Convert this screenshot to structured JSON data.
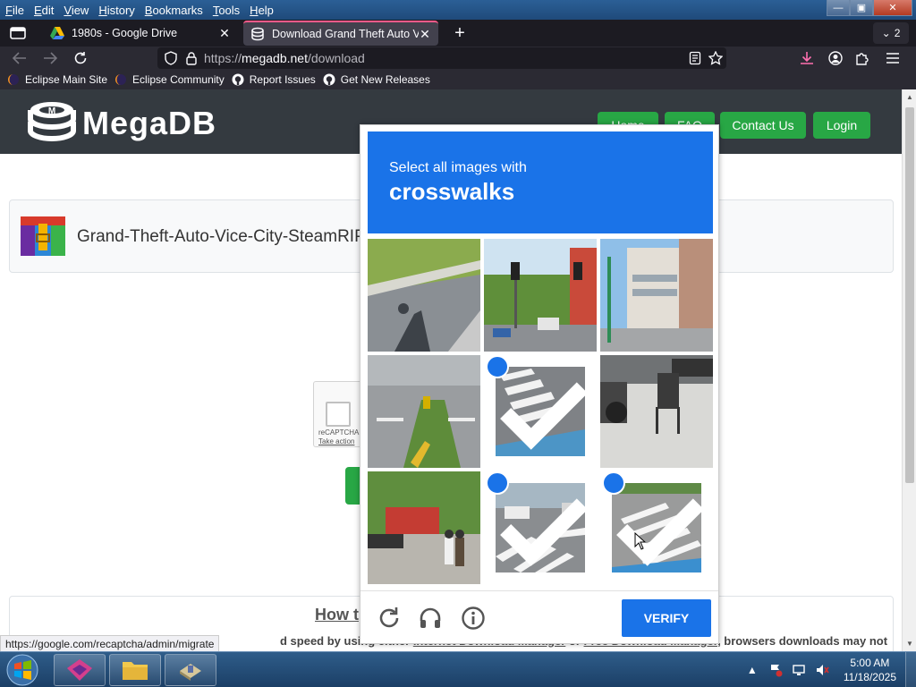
{
  "menu": {
    "items": [
      {
        "label": "File",
        "key": "F",
        "rest": "ile"
      },
      {
        "label": "Edit",
        "key": "E",
        "rest": "dit"
      },
      {
        "label": "View",
        "key": "V",
        "rest": "iew"
      },
      {
        "label": "History",
        "key": "H",
        "rest": "istory"
      },
      {
        "label": "Bookmarks",
        "key": "B",
        "rest": "ookmarks"
      },
      {
        "label": "Tools",
        "key": "T",
        "rest": "ools"
      },
      {
        "label": "Help",
        "key": "H",
        "rest": "elp"
      }
    ]
  },
  "tabs": [
    {
      "title": "1980s - Google Drive",
      "icon": "google-drive-icon"
    },
    {
      "title": "Download Grand Theft Auto Vic",
      "icon": "megadb-icon",
      "active": true
    }
  ],
  "tab_count": "2",
  "url": {
    "scheme": "https://",
    "host": "megadb.net",
    "path": "/download"
  },
  "bookmarks": [
    {
      "label": "Eclipse Main Site",
      "icon": "eclipse-icon"
    },
    {
      "label": "Eclipse Community",
      "icon": "eclipse-icon"
    },
    {
      "label": "Report Issues",
      "icon": "github-icon"
    },
    {
      "label": "Get New Releases",
      "icon": "github-icon"
    }
  ],
  "site": {
    "logo_text": "MegaDB",
    "nav": [
      "Home",
      "FAQ",
      "Contact Us",
      "Login"
    ],
    "file_name": "Grand-Theft-Auto-Vice-City-SteamRIP.c",
    "recaptcha_label": "reCAPTCHA",
    "recaptcha_action": "Take action",
    "howto_title": "How t",
    "howto_text_a": "d speed by using either ",
    "howto_link_a": "Internet Download Manager",
    "howto_text_b": " or ",
    "howto_link_b": "Free Download Manager",
    "howto_text_c": ", browsers downloads may not"
  },
  "status_link": "https://google.com/recaptcha/admin/migrate",
  "captcha": {
    "instruction": "Select all images with",
    "target": "crosswalks",
    "verify_label": "VERIFY",
    "tiles": [
      {
        "scene": "road-shadow",
        "selected": false
      },
      {
        "scene": "traffic-lights",
        "selected": false
      },
      {
        "scene": "buildings",
        "selected": false
      },
      {
        "scene": "intersection",
        "selected": false
      },
      {
        "scene": "crosswalk-closeup",
        "selected": true
      },
      {
        "scene": "motorcycle-sidewalk",
        "selected": false
      },
      {
        "scene": "pedestrians-street",
        "selected": false
      },
      {
        "scene": "crosswalk-cars",
        "selected": true
      },
      {
        "scene": "crosswalk-angled",
        "selected": true
      }
    ]
  },
  "taskbar": {
    "clock_time": "5:00 AM",
    "clock_date": "11/18/2025"
  },
  "colors": {
    "captcha_blue": "#1a73e8",
    "site_green": "#28a745",
    "site_header": "#343a40",
    "tab_accent": "#ff5a8a"
  }
}
